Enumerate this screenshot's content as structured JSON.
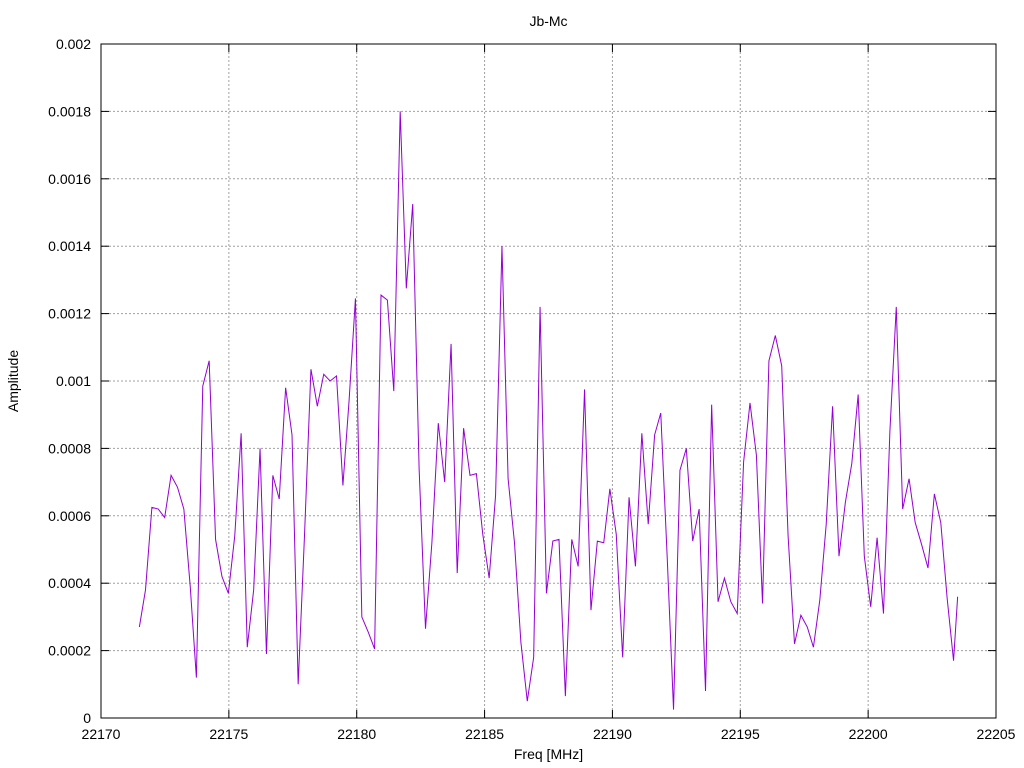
{
  "chart_data": {
    "type": "line",
    "title": "Jb-Mc",
    "xlabel": "Freq [MHz]",
    "ylabel": "Amplitude",
    "xlim": [
      22170,
      22205
    ],
    "ylim": [
      0,
      0.002
    ],
    "grid": true,
    "xticks": [
      22170,
      22175,
      22180,
      22185,
      22190,
      22195,
      22200,
      22205
    ],
    "xtick_labels": [
      "22170",
      "22175",
      "22180",
      "22185",
      "22190",
      "22195",
      "22200",
      "22205"
    ],
    "yticks": [
      0,
      0.0002,
      0.0004,
      0.0006,
      0.0008,
      0.001,
      0.0012,
      0.0014,
      0.0016,
      0.0018,
      0.002
    ],
    "ytick_labels": [
      "0",
      "0.0002",
      "0.0004",
      "0.0006",
      "0.0008",
      "0.001",
      "0.0012",
      "0.0014",
      "0.0016",
      "0.0018",
      "0.002"
    ],
    "line_color": "#9400d3",
    "series": [
      {
        "x": [
          22171.5,
          22171.74,
          22171.99,
          22172.24,
          22172.49,
          22172.74,
          22172.99,
          22173.24,
          22173.49,
          22173.73,
          22173.98,
          22174.23,
          22174.48,
          22174.73,
          22174.98,
          22175.23,
          22175.48,
          22175.72,
          22175.97,
          22176.22,
          22176.47,
          22176.72,
          22176.97,
          22177.22,
          22177.47,
          22177.71,
          22177.96,
          22178.21,
          22178.46,
          22178.71,
          22178.96,
          22179.21,
          22179.46,
          22179.7,
          22179.95,
          22180.2,
          22180.45,
          22180.7,
          22180.95,
          22181.2,
          22181.45,
          22181.7,
          22181.94,
          22182.19,
          22182.44,
          22182.69,
          22182.94,
          22183.19,
          22183.44,
          22183.69,
          22183.93,
          22184.18,
          22184.43,
          22184.68,
          22184.93,
          22185.18,
          22185.43,
          22185.68,
          22185.92,
          22186.17,
          22186.42,
          22186.67,
          22186.92,
          22187.17,
          22187.42,
          22187.67,
          22187.91,
          22188.16,
          22188.41,
          22188.66,
          22188.91,
          22189.16,
          22189.41,
          22189.66,
          22189.9,
          22190.15,
          22190.4,
          22190.65,
          22190.9,
          22191.15,
          22191.4,
          22191.65,
          22191.89,
          22192.14,
          22192.39,
          22192.64,
          22192.89,
          22193.14,
          22193.39,
          22193.64,
          22193.88,
          22194.13,
          22194.38,
          22194.63,
          22194.88,
          22195.13,
          22195.38,
          22195.63,
          22195.87,
          22196.12,
          22196.37,
          22196.62,
          22196.87,
          22197.12,
          22197.37,
          22197.62,
          22197.86,
          22198.11,
          22198.36,
          22198.61,
          22198.86,
          22199.11,
          22199.36,
          22199.61,
          22199.85,
          22200.1,
          22200.35,
          22200.6,
          22200.85,
          22201.1,
          22201.35,
          22201.6,
          22201.84,
          22202.09,
          22202.34,
          22202.59,
          22202.84,
          22203.09,
          22203.34,
          22203.5
        ],
        "y": [
          0.00027,
          0.00038,
          0.000625,
          0.00062,
          0.000595,
          0.00072,
          0.000685,
          0.00062,
          0.00039,
          0.00012,
          0.000985,
          0.00106,
          0.00053,
          0.00042,
          0.00037,
          0.00054,
          0.000845,
          0.00021,
          0.00038,
          0.0008,
          0.00019,
          0.00072,
          0.00065,
          0.00098,
          0.00084,
          0.0001,
          0.000545,
          0.001035,
          0.000925,
          0.00102,
          0.001,
          0.001015,
          0.00069,
          0.00094,
          0.001245,
          0.0003,
          0.000255,
          0.000205,
          0.001255,
          0.00124,
          0.00097,
          0.0018,
          0.001275,
          0.001525,
          0.00074,
          0.000265,
          0.00052,
          0.000875,
          0.0007,
          0.00111,
          0.00043,
          0.00086,
          0.00072,
          0.000725,
          0.000545,
          0.000415,
          0.00066,
          0.0014,
          0.00071,
          0.00052,
          0.000225,
          5e-05,
          0.00018,
          0.00122,
          0.00037,
          0.000525,
          0.00053,
          6.5e-05,
          0.00053,
          0.00045,
          0.000975,
          0.00032,
          0.000525,
          0.00052,
          0.00068,
          0.000545,
          0.00018,
          0.000655,
          0.00045,
          0.000845,
          0.000575,
          0.00084,
          0.000905,
          0.00048,
          2.5e-05,
          0.000735,
          0.0008,
          0.000525,
          0.00062,
          8e-05,
          0.00093,
          0.000345,
          0.000415,
          0.000345,
          0.00031,
          0.00076,
          0.000935,
          0.00078,
          0.00034,
          0.00106,
          0.001135,
          0.001045,
          0.00054,
          0.00022,
          0.000305,
          0.00027,
          0.00021,
          0.00035,
          0.000575,
          0.000925,
          0.00048,
          0.00064,
          0.000755,
          0.00096,
          0.00048,
          0.00033,
          0.000535,
          0.00031,
          0.00085,
          0.00122,
          0.00062,
          0.00071,
          0.00058,
          0.000515,
          0.000445,
          0.000665,
          0.00058,
          0.000355,
          0.00017,
          0.00036
        ]
      }
    ]
  }
}
